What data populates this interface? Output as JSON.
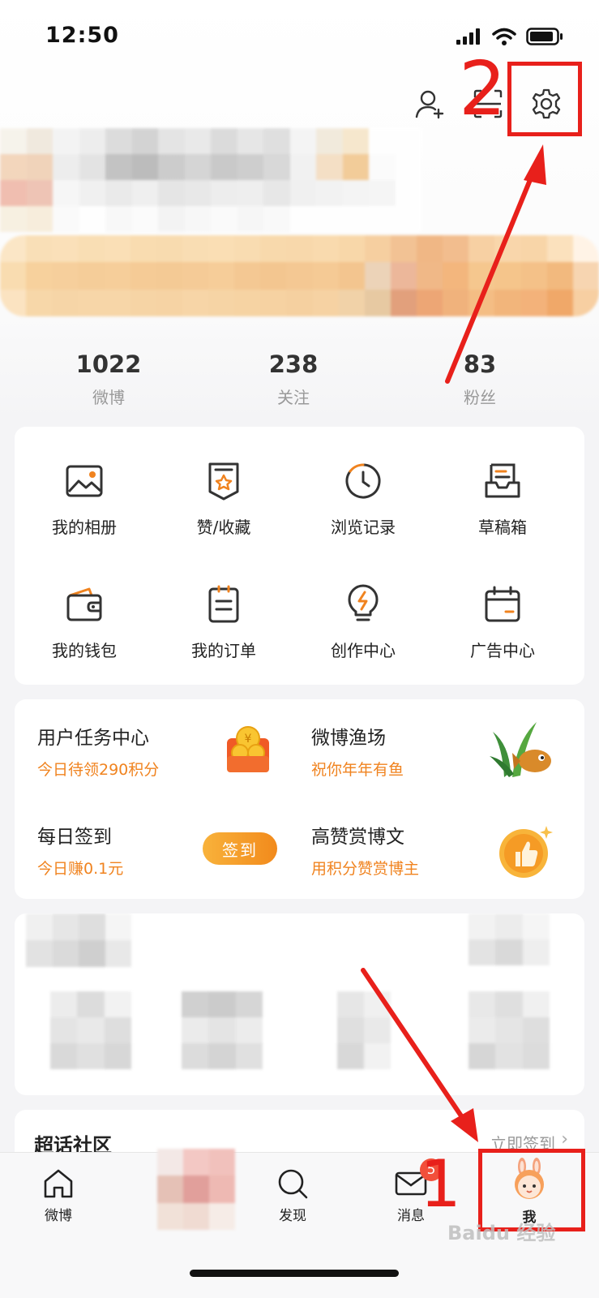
{
  "status_bar": {
    "time": "12:50"
  },
  "stats": [
    {
      "value": "1022",
      "label": "微博"
    },
    {
      "value": "238",
      "label": "关注"
    },
    {
      "value": "83",
      "label": "粉丝"
    }
  ],
  "grid": [
    {
      "label": "我的相册",
      "icon": "photo-album-icon"
    },
    {
      "label": "赞/收藏",
      "icon": "favorite-icon"
    },
    {
      "label": "浏览记录",
      "icon": "history-icon"
    },
    {
      "label": "草稿箱",
      "icon": "drafts-icon"
    },
    {
      "label": "我的钱包",
      "icon": "wallet-icon"
    },
    {
      "label": "我的订单",
      "icon": "order-icon"
    },
    {
      "label": "创作中心",
      "icon": "creator-icon"
    },
    {
      "label": "广告中心",
      "icon": "ad-center-icon"
    }
  ],
  "tasks": {
    "task_center": {
      "title": "用户任务中心",
      "subtitle": "今日待领290积分"
    },
    "fishing": {
      "title": "微博渔场",
      "subtitle": "祝你年年有鱼"
    },
    "checkin": {
      "title": "每日签到",
      "subtitle": "今日赚0.1元",
      "button": "签到"
    },
    "tip": {
      "title": "高赞赏博文",
      "subtitle": "用积分赞赏博主"
    }
  },
  "super_topic": {
    "title": "超话社区",
    "action": "立即签到"
  },
  "tabbar": [
    {
      "label": "微博",
      "icon": "home-icon"
    },
    {
      "label": "",
      "icon": "compose-icon"
    },
    {
      "label": "发现",
      "icon": "search-icon"
    },
    {
      "label": "消息",
      "icon": "mail-icon",
      "badge": "5"
    },
    {
      "label": "我",
      "icon": "avatar-icon"
    }
  ],
  "annotations": {
    "step1": "1",
    "step2": "2"
  },
  "watermark": "Baidu 经验",
  "colors": {
    "accent": "#f0831f",
    "annotation": "#e8201b"
  }
}
